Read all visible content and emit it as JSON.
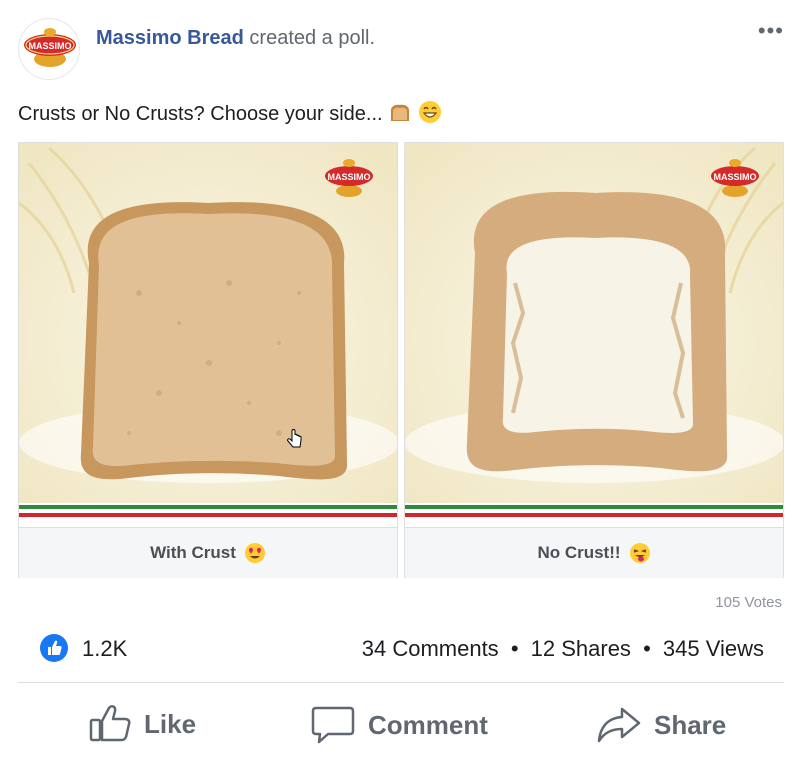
{
  "post": {
    "author_name": "Massimo Bread",
    "author_action": "created a poll.",
    "avatar_brand": "MASSIMO",
    "more_icon": "more-horizontal-icon",
    "text": "Crusts or No Crusts? Choose your side...",
    "text_emojis": [
      "bread-emoji",
      "grinning-face-emoji"
    ]
  },
  "poll": {
    "options": [
      {
        "label": "With Crust",
        "emoji": "heart-eyes-emoji",
        "image_brand": "MASSIMO"
      },
      {
        "label": "No Crust!!",
        "emoji": "winking-tongue-emoji",
        "image_brand": "MASSIMO"
      }
    ],
    "votes": "105 Votes"
  },
  "stats": {
    "likes": "1.2K",
    "comments": "34 Comments",
    "shares": "12 Shares",
    "views": "345 Views",
    "separator": "•"
  },
  "actions": {
    "like": "Like",
    "comment": "Comment",
    "share": "Share"
  },
  "colors": {
    "brand_blue": "#385898",
    "like_blue": "#1877f2",
    "stripe_green": "#2e8b3e",
    "stripe_red": "#d0262c"
  }
}
